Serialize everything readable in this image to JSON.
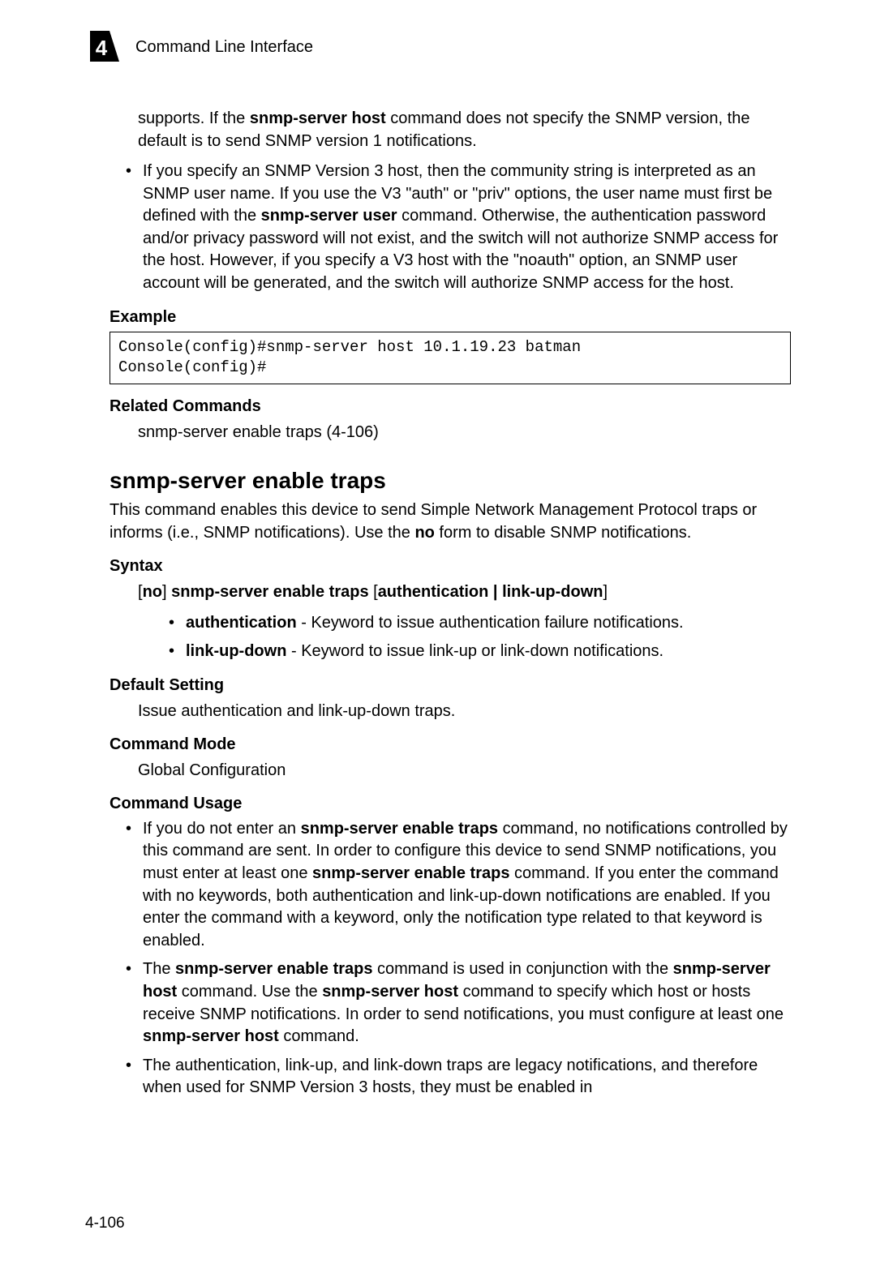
{
  "header": {
    "chapter_number": "4",
    "title": "Command Line Interface"
  },
  "intro": {
    "para1_pre": "supports. If the ",
    "para1_bold": "snmp-server host",
    "para1_post": " command does not specify the SNMP version, the default is to send SNMP version 1 notifications.",
    "bullet1_pre": "If you specify an SNMP Version 3 host, then the community string is interpreted as an SNMP user name. If you use the V3 \"auth\" or \"priv\" options, the user name must first be defined with the ",
    "bullet1_bold": "snmp-server user",
    "bullet1_post": " command. Otherwise, the authentication password and/or privacy password will not exist, and the switch will not authorize SNMP access for the host. However, if you specify a V3 host with the \"noauth\" option, an SNMP user account will be generated, and the switch will authorize SNMP access for the host."
  },
  "example": {
    "label": "Example",
    "code": "Console(config)#snmp-server host 10.1.19.23 batman\nConsole(config)#"
  },
  "related": {
    "label": "Related Commands",
    "text": "snmp-server enable traps (4-106)"
  },
  "cmd": {
    "title": "snmp-server enable traps",
    "desc_pre": "This command enables this device to send Simple Network Management Protocol traps or informs (i.e., SNMP notifications). Use the ",
    "desc_bold": "no",
    "desc_post": " form to disable SNMP notifications."
  },
  "syntax": {
    "label": "Syntax",
    "line_pre_bracket": "[",
    "line_no": "no",
    "line_mid1": "] ",
    "line_cmd": "snmp-server enable traps",
    "line_mid2": " [",
    "line_opts": "authentication | link-up-down",
    "line_post": "]",
    "opt1_bold": "authentication",
    "opt1_rest": " - Keyword to issue authentication failure notifications.",
    "opt2_bold": "link-up-down",
    "opt2_rest": " - Keyword to issue link-up or link-down notifications."
  },
  "default_setting": {
    "label": "Default Setting",
    "text": "Issue authentication and link-up-down traps."
  },
  "command_mode": {
    "label": "Command Mode",
    "text": "Global Configuration"
  },
  "usage": {
    "label": "Command Usage",
    "b1_pre": "If you do not enter an ",
    "b1_bold1": "snmp-server enable traps",
    "b1_mid1": " command, no notifications controlled by this command are sent. In order to configure this device to send SNMP notifications, you must enter at least one ",
    "b1_bold2": "snmp-server enable traps",
    "b1_post": " command. If you enter the command with no keywords, both authentication and link-up-down notifications are enabled. If you enter the command with a keyword, only the notification type related to that keyword is enabled.",
    "b2_pre": "The ",
    "b2_bold1": "snmp-server enable traps",
    "b2_mid1": " command is used in conjunction with the ",
    "b2_bold2": "snmp-server host",
    "b2_mid2": " command. Use the ",
    "b2_bold3": "snmp-server host",
    "b2_mid3": " command to specify which host or hosts receive SNMP notifications. In order to send notifications, you must configure at least one ",
    "b2_bold4": "snmp-server host",
    "b2_post": " command.",
    "b3": "The authentication, link-up, and link-down traps are legacy notifications, and therefore when used for SNMP Version 3 hosts, they must be enabled in"
  },
  "page_number": "4-106"
}
